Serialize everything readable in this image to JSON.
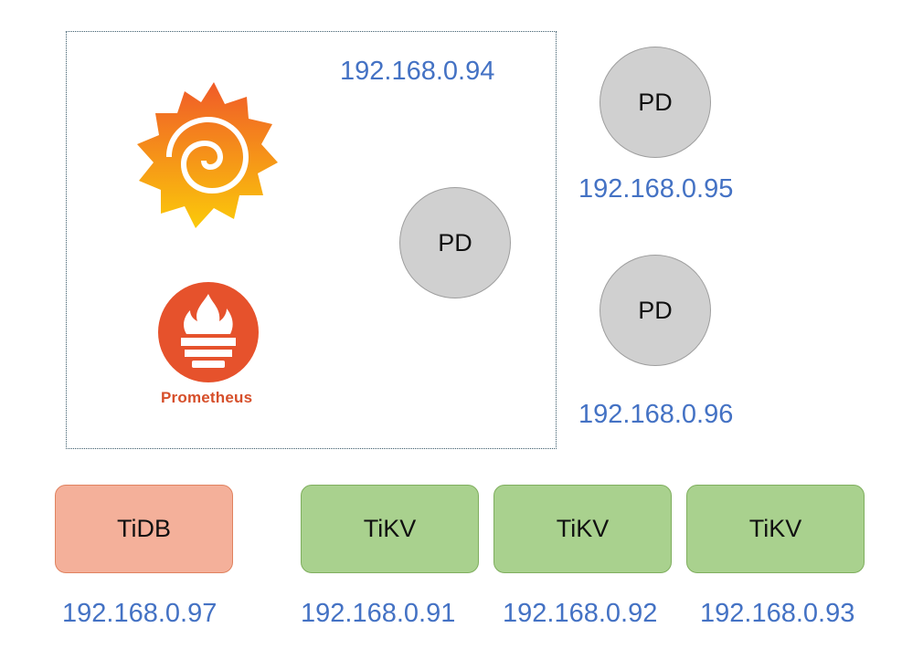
{
  "monitor_box": {
    "ip": "192.168.0.94",
    "pd_label": "PD",
    "grafana_logo": "grafana-icon",
    "prometheus_logo": "prometheus-icon",
    "prometheus_text": "Prometheus"
  },
  "pd_nodes": [
    {
      "label": "PD",
      "ip": "192.168.0.95"
    },
    {
      "label": "PD",
      "ip": "192.168.0.96"
    }
  ],
  "servers": [
    {
      "label": "TiDB",
      "ip": "192.168.0.97",
      "color": "#f4b09a"
    },
    {
      "label": "TiKV",
      "ip": "192.168.0.91",
      "color": "#a9d18e"
    },
    {
      "label": "TiKV",
      "ip": "192.168.0.92",
      "color": "#a9d18e"
    },
    {
      "label": "TiKV",
      "ip": "192.168.0.93",
      "color": "#a9d18e"
    }
  ],
  "colors": {
    "ip_text": "#4472c4",
    "pd_fill": "#d0d0d0",
    "prometheus": "#e6522c"
  }
}
